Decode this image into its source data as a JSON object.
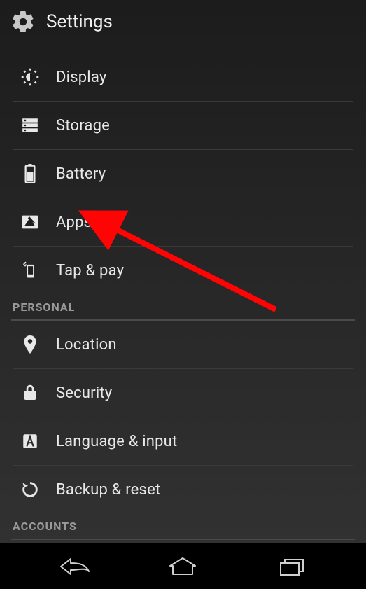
{
  "header": {
    "title": "Settings"
  },
  "sections": {
    "device_items": [
      {
        "icon": "display-icon",
        "label": "Display"
      },
      {
        "icon": "storage-icon",
        "label": "Storage"
      },
      {
        "icon": "battery-icon",
        "label": "Battery"
      },
      {
        "icon": "apps-icon",
        "label": "Apps"
      },
      {
        "icon": "tap-pay-icon",
        "label": "Tap & pay"
      }
    ],
    "personal_header": "PERSONAL",
    "personal_items": [
      {
        "icon": "location-icon",
        "label": "Location"
      },
      {
        "icon": "security-icon",
        "label": "Security"
      },
      {
        "icon": "language-icon",
        "label": "Language & input"
      },
      {
        "icon": "backup-icon",
        "label": "Backup & reset"
      }
    ],
    "accounts_header": "ACCOUNTS"
  },
  "annotation": {
    "arrow_color": "#ff0404",
    "target_item": "Apps"
  }
}
